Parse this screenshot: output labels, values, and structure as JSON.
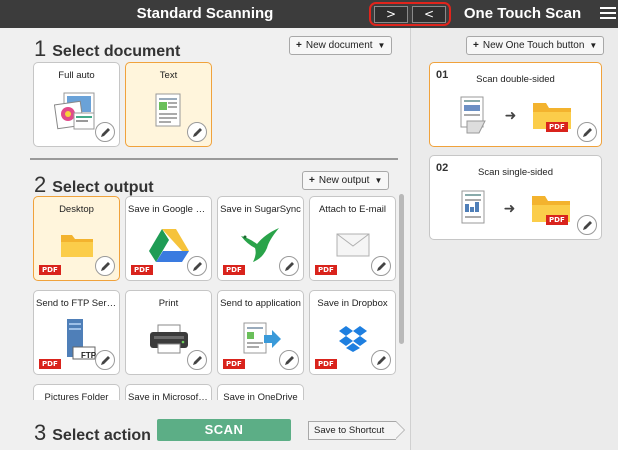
{
  "titlebar": {
    "left_title": "Standard Scanning",
    "nav_next": ">",
    "nav_prev": "<",
    "right_title": "One Touch Scan"
  },
  "colors": {
    "accent_selected": "#f0a23c",
    "scan_button": "#5cae86",
    "pdf_badge": "#d9231c",
    "titlebar": "#3c3c3c"
  },
  "step1": {
    "number": "1",
    "title": "Select document",
    "new_button": "New document",
    "cards": [
      {
        "label": "Full auto",
        "icon": "full-auto-photo-icon",
        "selected": false
      },
      {
        "label": "Text",
        "icon": "text-document-icon",
        "selected": true
      }
    ]
  },
  "step2": {
    "number": "2",
    "title": "Select output",
    "new_button": "New output",
    "cards": [
      {
        "label": "Desktop",
        "icon": "folder-icon",
        "badge": "PDF",
        "selected": true
      },
      {
        "label": "Save in Google Dri...",
        "icon": "google-drive-icon",
        "badge": "PDF",
        "selected": false
      },
      {
        "label": "Save in SugarSync",
        "icon": "sugarsync-bird-icon",
        "badge": "PDF",
        "selected": false
      },
      {
        "label": "Attach to E-mail",
        "icon": "envelope-icon",
        "badge": "PDF",
        "selected": false
      },
      {
        "label": "Send to FTP Server",
        "icon": "ftp-server-icon",
        "badge": "PDF",
        "selected": false
      },
      {
        "label": "Print",
        "icon": "printer-icon",
        "badge": "",
        "selected": false
      },
      {
        "label": "Send to application",
        "icon": "send-to-application-icon",
        "badge": "PDF",
        "selected": false
      },
      {
        "label": "Save in Dropbox",
        "icon": "dropbox-icon",
        "badge": "PDF",
        "selected": false
      },
      {
        "label": "Pictures Folder",
        "icon": "",
        "badge": "",
        "selected": false
      },
      {
        "label": "Save in Microsoft S...",
        "icon": "",
        "badge": "",
        "selected": false
      },
      {
        "label": "Save in OneDrive",
        "icon": "",
        "badge": "",
        "selected": false
      }
    ],
    "ftp_label": "FTP"
  },
  "step3": {
    "number": "3",
    "title": "Select action",
    "scan_button": "SCAN",
    "shortcut_button": "Save to Shortcut"
  },
  "one_touch": {
    "new_button": "New One Touch button",
    "cards": [
      {
        "num": "01",
        "title": "Scan double-sided",
        "badge": "PDF",
        "selected": true
      },
      {
        "num": "02",
        "title": "Scan single-sided",
        "badge": "PDF",
        "selected": false
      }
    ]
  }
}
